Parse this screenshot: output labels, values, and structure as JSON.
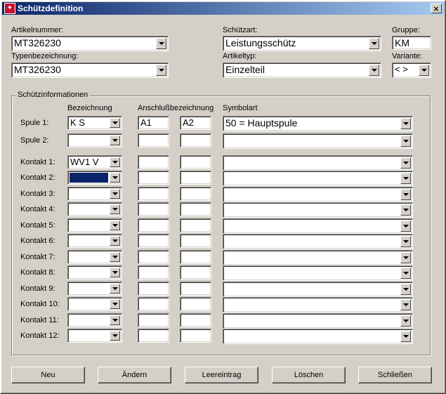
{
  "window": {
    "title": "Schützdefinition",
    "close": "×"
  },
  "header": {
    "artikelnummer_label": "Artikelnummer:",
    "artikelnummer_value": "MT326230",
    "typenbezeichnung_label": "Typenbezeichnung:",
    "typenbezeichnung_value": "MT326230",
    "schuetzart_label": "Schützart:",
    "schuetzart_value": "Leistungsschütz",
    "artikeltyp_label": "Artikeltyp:",
    "artikeltyp_value": "Einzelteil",
    "gruppe_label": "Gruppe:",
    "gruppe_value": "KM",
    "variante_label": "Variante:",
    "variante_value": "< >"
  },
  "info": {
    "title": "Schützinformationen",
    "col_bezeichnung": "Bezeichnung",
    "col_anschluss": "Anschlußbezeichnung",
    "col_symbolart": "Symbolart",
    "rows": [
      {
        "label": "Spule 1:",
        "bez": "K        S",
        "a1": "A1",
        "a2": "A2",
        "sym": "50 = Hauptspule"
      },
      {
        "label": "Spule 2:",
        "bez": "",
        "a1": "",
        "a2": "",
        "sym": ""
      },
      {
        "label": "Kontakt 1:",
        "bez": "WV1    V",
        "a1": "",
        "a2": "",
        "sym": ""
      },
      {
        "label": "Kontakt 2:",
        "bez": "",
        "a1": "",
        "a2": "",
        "sym": ""
      },
      {
        "label": "Kontakt 3:",
        "bez": "",
        "a1": "",
        "a2": "",
        "sym": ""
      },
      {
        "label": "Kontakt 4:",
        "bez": "",
        "a1": "",
        "a2": "",
        "sym": ""
      },
      {
        "label": "Kontakt 5:",
        "bez": "",
        "a1": "",
        "a2": "",
        "sym": ""
      },
      {
        "label": "Kontakt 6:",
        "bez": "",
        "a1": "",
        "a2": "",
        "sym": ""
      },
      {
        "label": "Kontakt 7:",
        "bez": "",
        "a1": "",
        "a2": "",
        "sym": ""
      },
      {
        "label": "Kontakt 8:",
        "bez": "",
        "a1": "",
        "a2": "",
        "sym": ""
      },
      {
        "label": "Kontakt 9:",
        "bez": "",
        "a1": "",
        "a2": "",
        "sym": ""
      },
      {
        "label": "Kontakt 10:",
        "bez": "",
        "a1": "",
        "a2": "",
        "sym": ""
      },
      {
        "label": "Kontakt 11:",
        "bez": "",
        "a1": "",
        "a2": "",
        "sym": ""
      },
      {
        "label": "Kontakt 12:",
        "bez": "",
        "a1": "",
        "a2": "",
        "sym": ""
      }
    ]
  },
  "buttons": {
    "neu": "Neu",
    "aendern": "Ändern",
    "leereintrag": "Leereintrag",
    "loeschen": "Löschen",
    "schliessen": "Schließen"
  },
  "colors": {
    "face": "#d4d0c8",
    "title_start": "#0a246a",
    "title_end": "#a6caf0",
    "selection": "#0a246a"
  }
}
